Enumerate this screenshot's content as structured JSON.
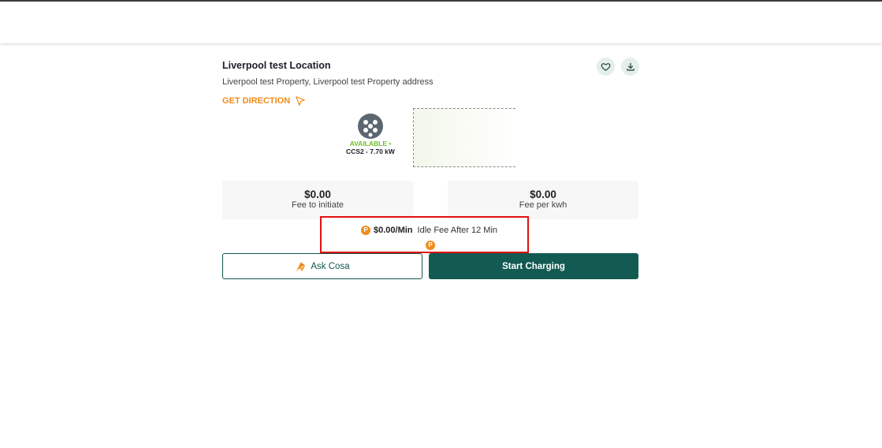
{
  "location": {
    "title": "Liverpool test Location",
    "address": "Liverpool test Property, Liverpool test Property address",
    "direction_label": "GET DIRECTION"
  },
  "icons": {
    "favorite": "heart-icon",
    "download": "download-icon",
    "direction": "navigation-arrow-icon",
    "connector": "ccs2-plug-icon",
    "coin": "points-coin-icon",
    "ask": "cosa-logo-icon"
  },
  "connector": {
    "status": "AVAILABLE •",
    "type": "CCS2 - 7.70 kW"
  },
  "fees": {
    "initiate": {
      "value": "$0.00",
      "label": "Fee to initiate"
    },
    "per_kwh": {
      "value": "$0.00",
      "label": "Fee per kwh"
    }
  },
  "idle": {
    "coin_symbol": "P",
    "value": "$0.00/Min",
    "text": "Idle Fee After 12 Min"
  },
  "buttons": {
    "ask": "Ask Cosa",
    "start": "Start Charging"
  },
  "colors": {
    "accent_orange": "#f28c1a",
    "primary_green": "#125a52",
    "available_green": "#6cbf2a",
    "highlight_red": "#e21010"
  }
}
